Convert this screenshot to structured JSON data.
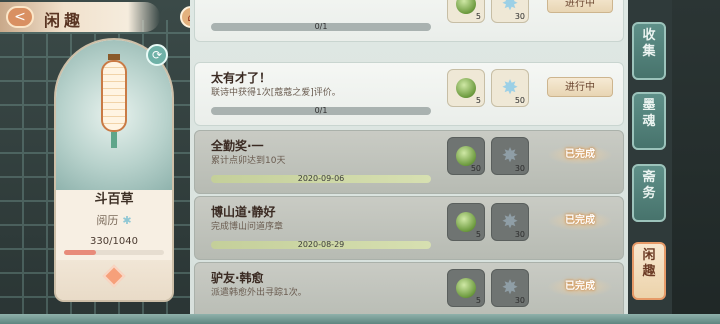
{
  "header": {
    "back_glyph": "<",
    "title": "闲趣",
    "home_glyph": "⌂"
  },
  "character": {
    "name": "斗百草",
    "exp_label": "阅历",
    "exp_value": "330/1040",
    "exp_progress": 0.317,
    "refresh_glyph": "⟳"
  },
  "tasks": [
    {
      "title": "",
      "desc": "",
      "progress_text": "0/1",
      "jade_count": "5",
      "star_count": "30",
      "status": "进行中",
      "done": false
    },
    {
      "title": "太有才了！",
      "desc": "联诗中获得1次[蔻蔻之爱]评价。",
      "progress_text": "0/1",
      "jade_count": "5",
      "star_count": "50",
      "status": "进行中",
      "done": false
    },
    {
      "title": "全勤奖·一",
      "desc": "累计点卯达到10天",
      "progress_text": "2020-09-06",
      "jade_count": "50",
      "star_count": "30",
      "status": "已完成",
      "done": true
    },
    {
      "title": "博山道·静好",
      "desc": "完成博山问道序章",
      "progress_text": "2020-08-29",
      "jade_count": "5",
      "star_count": "30",
      "status": "已完成",
      "done": true
    },
    {
      "title": "驴友·韩愈",
      "desc": "派遣韩愈外出寻踪1次。",
      "progress_text": "",
      "jade_count": "5",
      "star_count": "30",
      "status": "已完成",
      "done": true
    }
  ],
  "tabs": [
    {
      "label": "收\n集",
      "active": false
    },
    {
      "label": "墨\n魂",
      "active": false
    },
    {
      "label": "斋\n务",
      "active": false
    },
    {
      "label": "闲\n趣",
      "active": true
    }
  ],
  "colors": {
    "accent_orange": "#e69a68",
    "teal": "#5f9089"
  }
}
